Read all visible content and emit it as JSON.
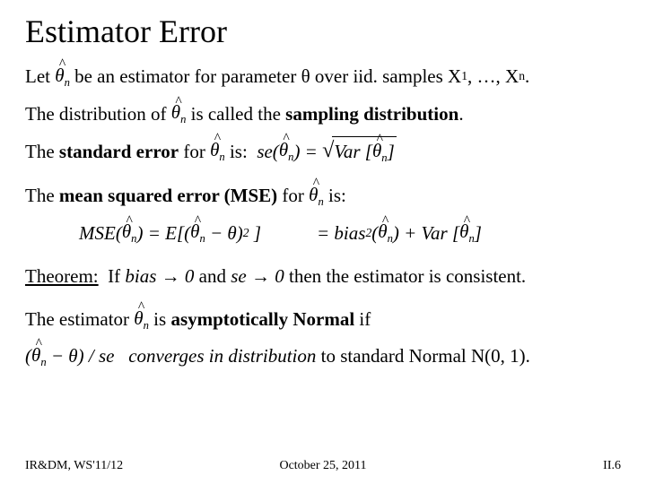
{
  "title": "Estimator Error",
  "sym": {
    "theta_hat_n": "θ̂n",
    "theta": "θ",
    "arrow": "→"
  },
  "l1": {
    "a": "Let ",
    "b": " be an estimator for parameter ",
    "c": " over iid. samples X",
    "d": ", …, X",
    "e": ".",
    "s1": "1",
    "sn": "n"
  },
  "l2": {
    "a": "The distribution of ",
    "b": " is called the ",
    "c": "sampling distribution",
    "d": "."
  },
  "l3": {
    "a": "The ",
    "b": "standard error",
    "c": " for ",
    "d": " is:  "
  },
  "se_eq": {
    "lhs_a": "se(",
    "lhs_b": ") = ",
    "sqrt_a": "Var [",
    "sqrt_b": "]"
  },
  "l4": {
    "a": "The ",
    "b": "mean squared error (MSE)",
    "c": " for ",
    "d": " is:"
  },
  "mse": {
    "row1_a": "MSE(",
    "row1_b": ") = E[(",
    "row1_c": " − θ)",
    "row1_sup": "2",
    "row1_d": " ]",
    "row2_a": "= bias",
    "row2_sup": "2",
    "row2_b": "(",
    "row2_c": ") + Var [",
    "row2_d": "]"
  },
  "thm": {
    "label": "Theorem:",
    "a": "  If ",
    "b": "bias",
    "c": " 0",
    "d": " and ",
    "e": "se",
    "f": " 0",
    "g": " then the estimator is consistent."
  },
  "l6": {
    "a": "The estimator ",
    "b": " is ",
    "c": "asymptotically Normal",
    "d": " if"
  },
  "l7": {
    "lp": "(",
    "mid": " − θ) / se   ",
    "a": "converges in distribution",
    "b": " to standard Normal N(0, 1)."
  },
  "footer": {
    "left": "IR&DM, WS'11/12",
    "center": "October 25, 2011",
    "right": "II.6"
  }
}
